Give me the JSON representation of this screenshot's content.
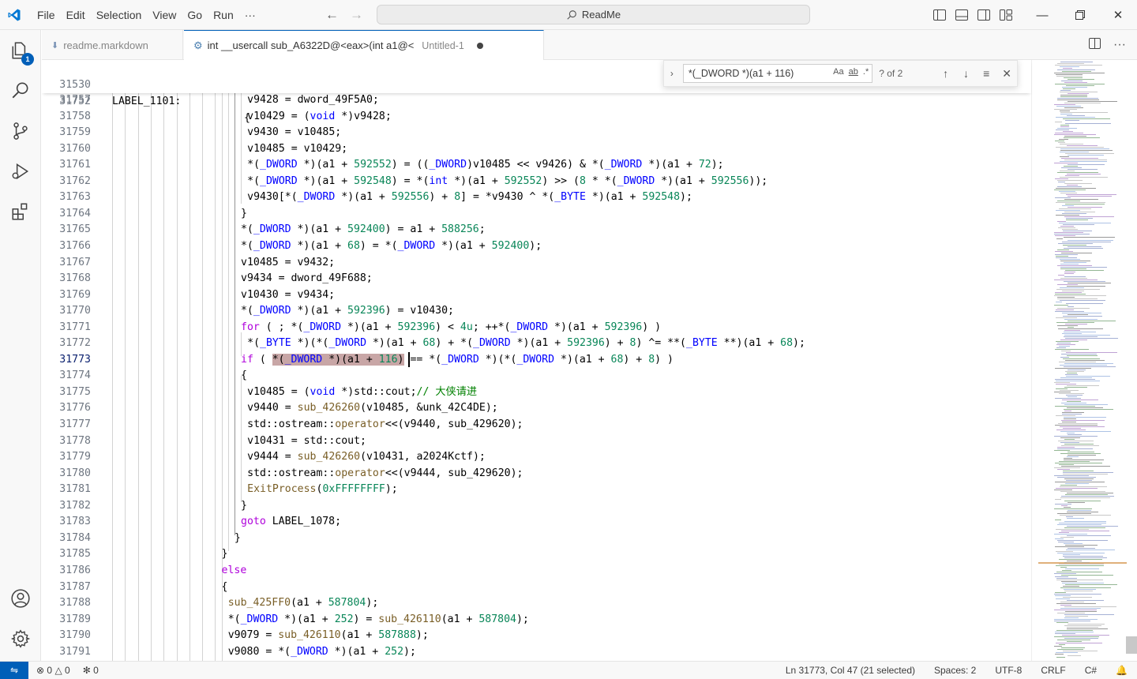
{
  "window": {
    "search_text": "ReadMe"
  },
  "menu": [
    "File",
    "Edit",
    "Selection",
    "View",
    "Go",
    "Run",
    "···"
  ],
  "activity": {
    "explorer_badge": "1"
  },
  "tabs": [
    {
      "label": "readme.markdown",
      "active": false
    },
    {
      "label": "int __usercall sub_A6322D@<eax>(int a1@<",
      "description": "Untitled-1",
      "active": true,
      "dirty": true
    }
  ],
  "find": {
    "query": "*(_DWORD *)(a1 + 116)",
    "count": "? of 2",
    "opt_case": "Aa",
    "opt_word": "ab",
    "opt_regex": ".*"
  },
  "sticky_line": {
    "number": "31530",
    "text": "LABEL_1101:"
  },
  "code_lines": [
    {
      "n": "31752",
      "t": "{"
    },
    {
      "n": "31757",
      "t": "v9428 = dword_49F5A0;"
    },
    {
      "n": "31758",
      "t": "v10429 = (void *)v9428;"
    },
    {
      "n": "31759",
      "t": "v9430 = v10485;"
    },
    {
      "n": "31760",
      "t": "v10485 = v10429;"
    },
    {
      "n": "31761",
      "t": "*(_DWORD *)(a1 + 592552) = ((_DWORD)v10485 << v9426) & *(_DWORD *)(a1 + 72);"
    },
    {
      "n": "31762",
      "t": "*(_DWORD *)(a1 + 592548) = *(int *)(a1 + 592552) >> (8 * *(_DWORD *)(a1 + 592556));"
    },
    {
      "n": "31763",
      "t": "v9430[*(_DWORD *)(a1 + 592556) + 8] = *v9430 ^ *(_BYTE *)(a1 + 592548);"
    },
    {
      "n": "31764",
      "t": "}"
    },
    {
      "n": "31765",
      "t": "*(_DWORD *)(a1 + 592400) = a1 + 588256;"
    },
    {
      "n": "31766",
      "t": "*(_DWORD *)(a1 + 68) = *(_DWORD *)(a1 + 592400);"
    },
    {
      "n": "31767",
      "t": "v10485 = v9432;"
    },
    {
      "n": "31768",
      "t": "v9434 = dword_49F688;"
    },
    {
      "n": "31769",
      "t": "v10430 = v9434;"
    },
    {
      "n": "31770",
      "t": "*(_DWORD *)(a1 + 592396) = v10430;"
    },
    {
      "n": "31771",
      "t": "for ( ; *(_DWORD *)(a1 + 592396) < 4u; ++*(_DWORD *)(a1 + 592396) )"
    },
    {
      "n": "31772",
      "t": "*(_BYTE *)(*(_DWORD *)(a1 + 68) + *(_DWORD *)(a1 + 592396) + 8) ^= **(_BYTE **)(a1 + 68);"
    },
    {
      "n": "31773",
      "t": "if ( *(_DWORD *)(a1 + 116) == *(_DWORD *)(*(_DWORD *)(a1 + 68) + 8) )"
    },
    {
      "n": "31774",
      "t": "{"
    },
    {
      "n": "31775",
      "t": "v10485 = (void *)std::cout;// 大侠请进"
    },
    {
      "n": "31776",
      "t": "v9440 = sub_426260(v10485, &unk_42C4DE);"
    },
    {
      "n": "31777",
      "t": "std::ostream::operator<<(v9440, sub_429620);"
    },
    {
      "n": "31778",
      "t": "v10431 = std::cout;"
    },
    {
      "n": "31779",
      "t": "v9444 = sub_426260(v10431, a2024Kctf);"
    },
    {
      "n": "31780",
      "t": "std::ostream::operator<<(v9444, sub_429620);"
    },
    {
      "n": "31781",
      "t": "ExitProcess(0xFFFFFFFF);"
    },
    {
      "n": "31782",
      "t": "}"
    },
    {
      "n": "31783",
      "t": "goto LABEL_1078;"
    },
    {
      "n": "31784",
      "t": "}"
    },
    {
      "n": "31785",
      "t": "}"
    },
    {
      "n": "31786",
      "t": "else"
    },
    {
      "n": "31787",
      "t": "{"
    },
    {
      "n": "31788",
      "t": "sub_425FF0(a1 + 587804);"
    },
    {
      "n": "31789",
      "t": "*(_DWORD *)(a1 + 252) = sub_426110(a1 + 587804);"
    },
    {
      "n": "31790",
      "t": "v9079 = sub_426110(a1 + 587888);"
    },
    {
      "n": "31791",
      "t": "v9080 = *(_DWORD *)(a1 + 252);"
    }
  ],
  "current_line": "31773",
  "status": {
    "errors": "0",
    "warnings": "0",
    "ports": "0",
    "position": "Ln 31773, Col 47 (21 selected)",
    "spaces": "Spaces: 2",
    "encoding": "UTF-8",
    "eol": "CRLF",
    "language": "C#"
  },
  "colors": {
    "accent": "#005fb8",
    "keyword": "#af00db",
    "type": "#0000ff",
    "function": "#795e26",
    "number": "#098658",
    "comment": "#008000",
    "selection": "#c8a6a6"
  }
}
